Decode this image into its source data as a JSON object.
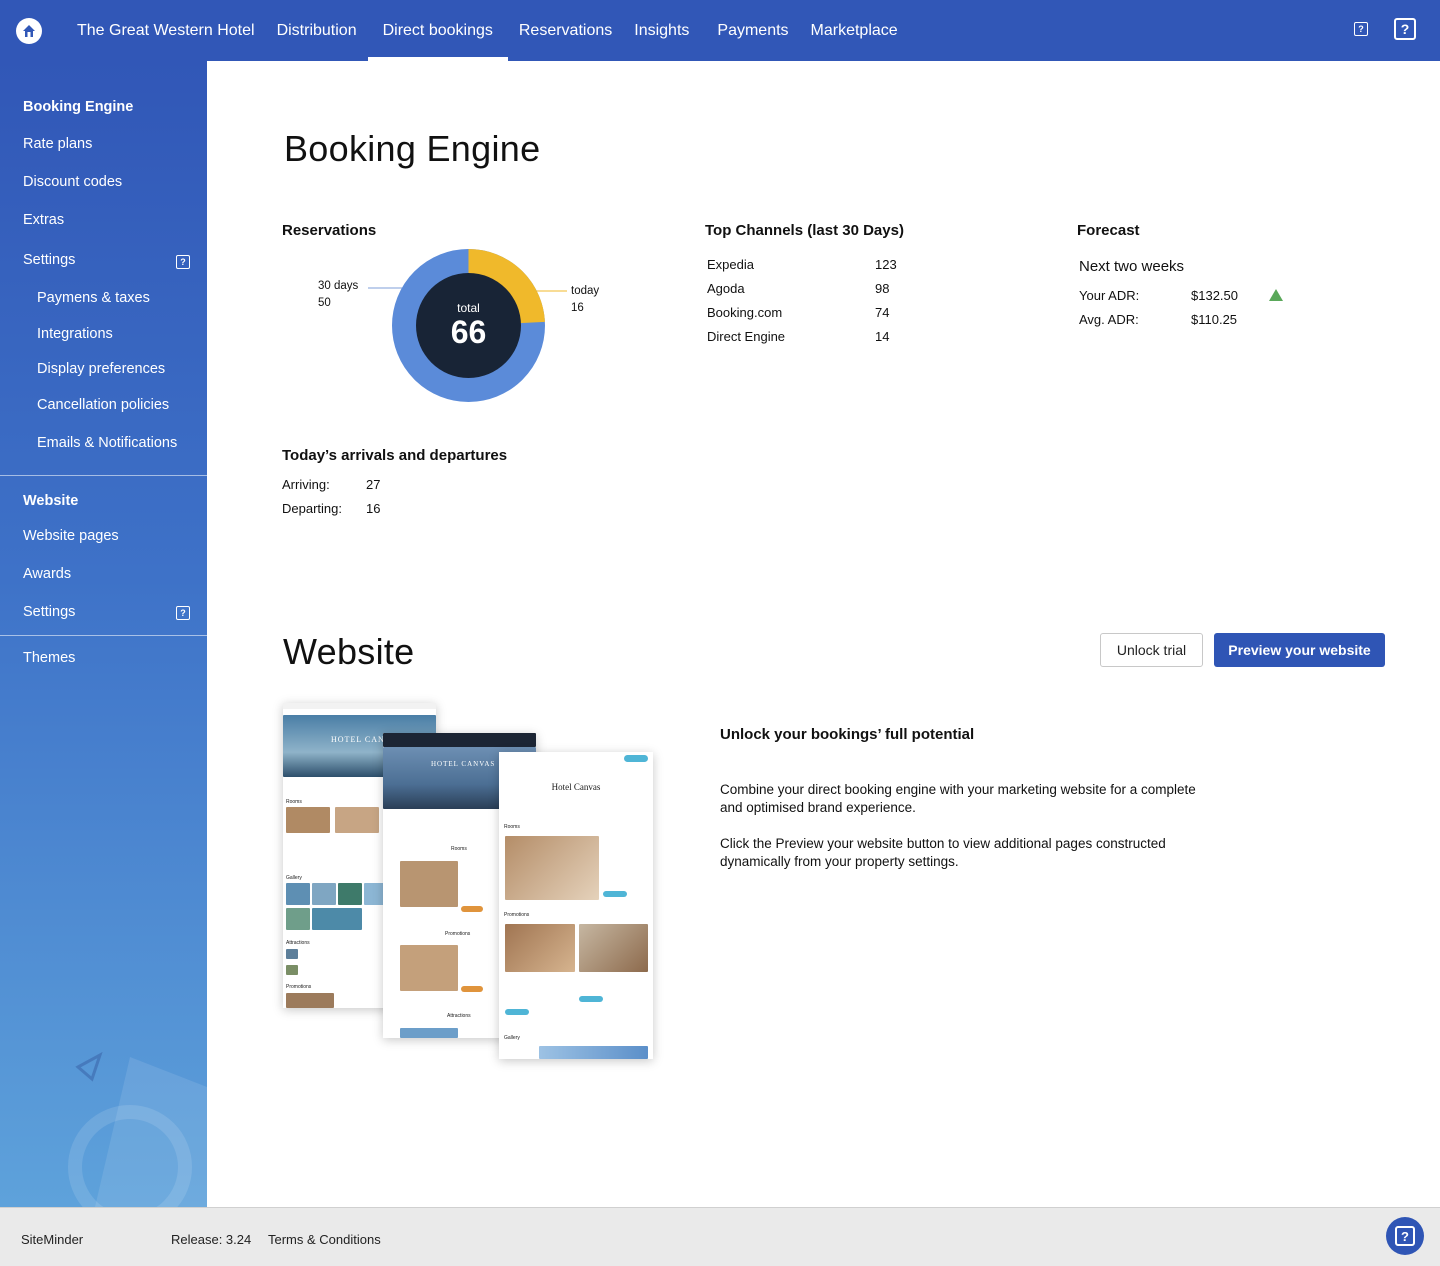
{
  "header": {
    "property": "The Great Western Hotel",
    "nav": [
      "Distribution",
      "Direct bookings",
      "Reservations",
      "Insights",
      "Payments",
      "Marketplace"
    ],
    "active_index": 1,
    "help_glyph": "?"
  },
  "sidebar": {
    "booking_engine": "Booking Engine",
    "rate_plans": "Rate plans",
    "discount_codes": "Discount codes",
    "extras": "Extras",
    "settings": "Settings",
    "payments_taxes": "Paymens & taxes",
    "integrations": "Integrations",
    "display_preferences": "Display preferences",
    "cancellation_policies": "Cancellation policies",
    "emails_notifications": "Emails & Notifications",
    "website": "Website",
    "website_pages": "Website pages",
    "awards": "Awards",
    "website_settings": "Settings",
    "themes": "Themes"
  },
  "booking_engine": {
    "title": "Booking Engine",
    "reservations": {
      "title": "Reservations",
      "total_label": "total",
      "total": "66",
      "period_label": "30 days",
      "period_value": "50",
      "today_label": "today",
      "today_value": "16"
    },
    "top_channels": {
      "title": "Top Channels (last 30 Days)",
      "rows": [
        {
          "name": "Expedia",
          "value": "123"
        },
        {
          "name": "Agoda",
          "value": "98"
        },
        {
          "name": "Booking.com",
          "value": "74"
        },
        {
          "name": "Direct Engine",
          "value": "14"
        }
      ]
    },
    "forecast": {
      "title": "Forecast",
      "subtitle": "Next two weeks",
      "your_adr_label": "Your ADR:",
      "your_adr": "$132.50",
      "avg_adr_label": "Avg. ADR:",
      "avg_adr": "$110.25",
      "trend_color": "#5aa85a"
    },
    "arrivals": {
      "title": "Today’s arrivals and departures",
      "arriving_label": "Arriving:",
      "arriving": "27",
      "departing_label": "Departing:",
      "departing": "16"
    }
  },
  "website": {
    "title": "Website",
    "unlock_button": "Unlock trial",
    "preview_button": "Preview your website",
    "promo_title": "Unlock your bookings’ full potential",
    "para1": "Combine your direct booking engine with your marketing website for a complete and optimised brand experience.",
    "para2": "Click the Preview your website button to view additional pages constructed dynamically from your property settings."
  },
  "mockups": {
    "hotel_name": "HOTEL CANVAS",
    "hotel_name_title": "Hotel Canvas",
    "rooms": "Rooms",
    "promotions": "Promotions",
    "gallery": "Gallery",
    "attractions": "Attractions"
  },
  "footer": {
    "brand": "SiteMinder",
    "release": "Release: 3.24",
    "terms": "Terms & Conditions"
  },
  "colors": {
    "brand_blue": "#3157b7",
    "donut_blue": "#5b8bd9",
    "donut_yellow": "#f0b92b",
    "donut_center": "#182436"
  }
}
